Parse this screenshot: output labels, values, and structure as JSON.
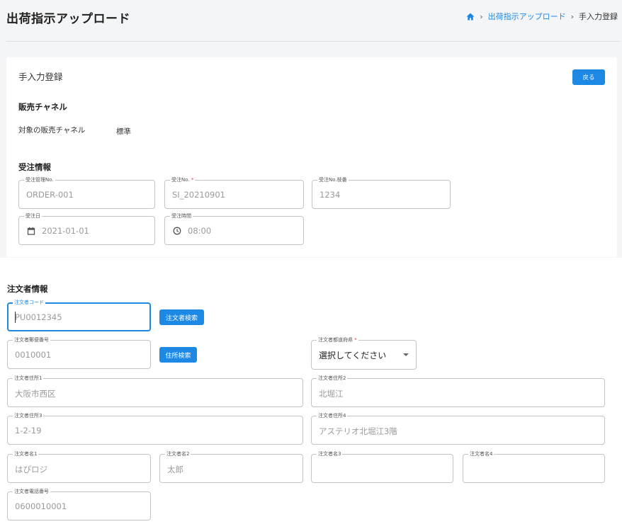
{
  "header": {
    "title": "出荷指示アップロード",
    "breadcrumb": {
      "link": "出荷指示アップロード",
      "current": "手入力登録"
    }
  },
  "card": {
    "heading": "手入力登録",
    "back_label": "戻る"
  },
  "sales_channel": {
    "title": "販売チャネル",
    "label": "対象の販売チャネル",
    "value": "標準"
  },
  "order_info": {
    "title": "受注情報",
    "management_no": {
      "label": "受注管理No.",
      "value": "ORDER-001"
    },
    "order_no": {
      "label": "受注No.",
      "required": "*",
      "value": "SI_20210901"
    },
    "branch_no": {
      "label": "受注No.枝番",
      "value": "1234"
    },
    "order_date": {
      "label": "受注日",
      "value": "2021-01-01"
    },
    "order_time": {
      "label": "受注時間",
      "value": "08:00"
    }
  },
  "orderer_info": {
    "title": "注文者情報",
    "code": {
      "label": "注文者コード",
      "value": "PU0012345"
    },
    "search_button": "注文者検索",
    "postal": {
      "label": "注文者郵便番号",
      "value": "0010001"
    },
    "address_search_button": "住所検索",
    "prefecture": {
      "label": "注文者都道府県",
      "required": "*",
      "value": "選択してください"
    },
    "address1": {
      "label": "注文者住所1",
      "value": "大阪市西区"
    },
    "address2": {
      "label": "注文者住所2",
      "value": "北堀江"
    },
    "address3": {
      "label": "注文者住所3",
      "value": "1-2-19"
    },
    "address4": {
      "label": "注文者住所4",
      "value": "アステリオ北堀江3階"
    },
    "name1": {
      "label": "注文者名1",
      "value": "はぴロジ"
    },
    "name2": {
      "label": "注文者名2",
      "value": "太郎"
    },
    "name3": {
      "label": "注文者名3",
      "value": ""
    },
    "name4": {
      "label": "注文者名4",
      "value": ""
    },
    "phone": {
      "label": "注文者電話番号",
      "value": "0600010001"
    }
  }
}
